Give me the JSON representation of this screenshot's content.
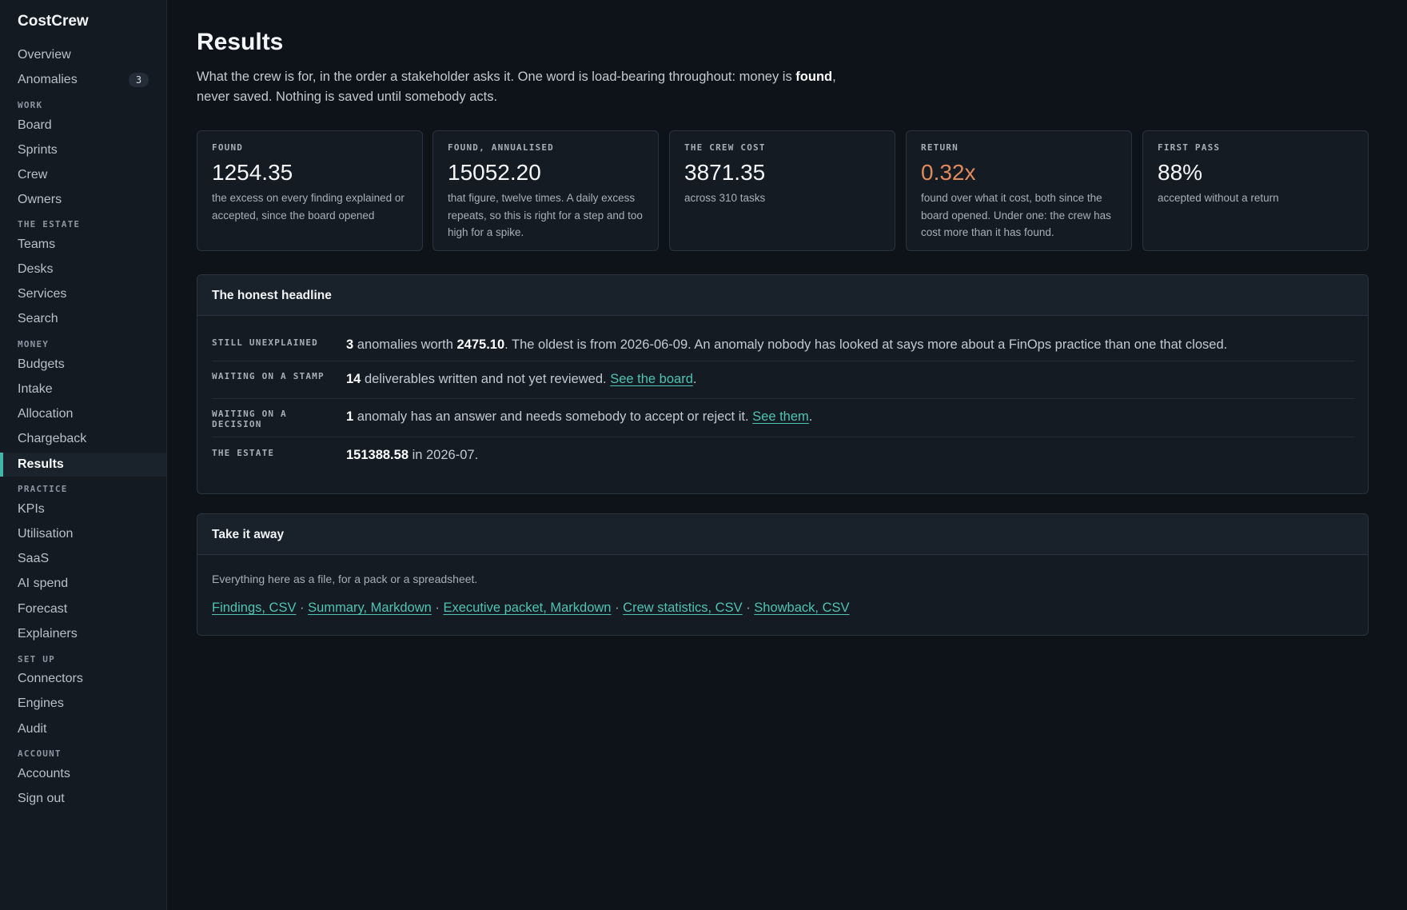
{
  "app": {
    "name": "CostCrew"
  },
  "sidebar": {
    "overview": "Overview",
    "anomalies": "Anomalies",
    "anomalies_count": "3",
    "sections": {
      "work": "WORK",
      "estate": "THE ESTATE",
      "money": "MONEY",
      "practice": "PRACTICE",
      "setup": "SET UP",
      "account": "ACCOUNT"
    },
    "work": [
      "Board",
      "Sprints",
      "Crew",
      "Owners"
    ],
    "estate": [
      "Teams",
      "Desks",
      "Services",
      "Search"
    ],
    "money": [
      "Budgets",
      "Intake",
      "Allocation",
      "Chargeback",
      "Results"
    ],
    "practice": [
      "KPIs",
      "Utilisation",
      "SaaS",
      "AI spend",
      "Forecast",
      "Explainers"
    ],
    "setup": [
      "Connectors",
      "Engines",
      "Audit"
    ],
    "account": [
      "Accounts",
      "Sign out"
    ]
  },
  "page": {
    "title": "Results",
    "intro_before": "What the crew is for, in the order a stakeholder asks it. One word is load-bearing throughout: money is ",
    "intro_bold": "found",
    "intro_after": ", never saved. Nothing is saved until somebody acts."
  },
  "cards": [
    {
      "label": "FOUND",
      "value": "1254.35",
      "desc": "the excess on every finding explained or accepted, since the board opened"
    },
    {
      "label": "FOUND, ANNUALISED",
      "value": "15052.20",
      "desc": "that figure, twelve times. A daily excess repeats, so this is right for a step and too high for a spike."
    },
    {
      "label": "THE CREW COST",
      "value": "3871.35",
      "desc": "across 310 tasks"
    },
    {
      "label": "RETURN",
      "value": "0.32x",
      "desc": "found over what it cost, both since the board opened. Under one: the crew has cost more than it has found."
    },
    {
      "label": "FIRST PASS",
      "value": "88%",
      "desc": "accepted without a return"
    }
  ],
  "headline": {
    "title": "The honest headline",
    "unexplained": {
      "label": "STILL UNEXPLAINED",
      "count": "3",
      "text1": " anomalies worth ",
      "amount": "2475.10",
      "text2": ". The oldest is from 2026-06-09. An anomaly nobody has looked at says more about a FinOps practice than one that closed."
    },
    "stamp": {
      "label": "WAITING ON A STAMP",
      "count": "14",
      "text": " deliverables written and not yet reviewed. ",
      "link": "See the board",
      "end": "."
    },
    "decision": {
      "label_line1": "WAITING ON A",
      "label_line2": "DECISION",
      "count": "1",
      "text": " anomaly has an answer and needs somebody to accept or reject it. ",
      "link": "See them",
      "end": "."
    },
    "estate": {
      "label": "THE ESTATE",
      "amount": "151388.58",
      "text": " in 2026-07."
    }
  },
  "takeaway": {
    "title": "Take it away",
    "intro": "Everything here as a file, for a pack or a spreadsheet.",
    "separator": " · ",
    "links": [
      "Findings, CSV",
      "Summary, Markdown",
      "Executive packet, Markdown",
      "Crew statistics, CSV",
      "Showback, CSV"
    ]
  }
}
